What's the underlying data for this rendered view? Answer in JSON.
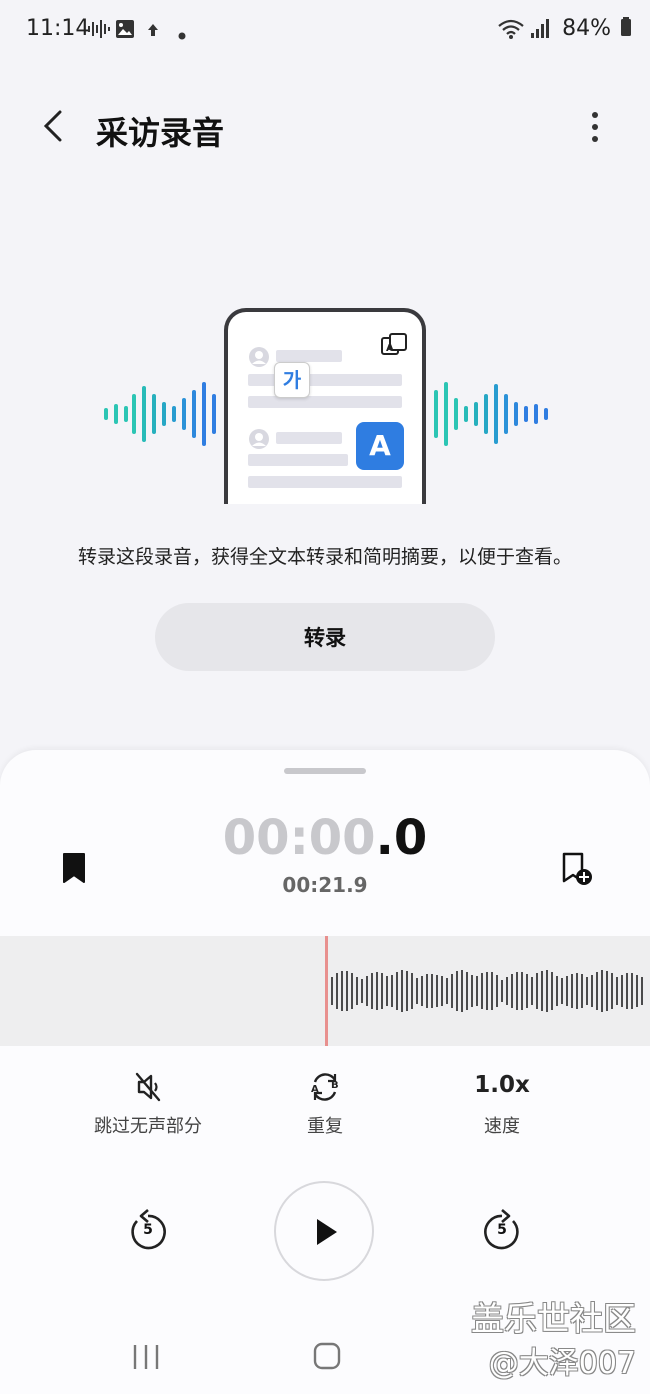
{
  "status_bar": {
    "time": "11:14",
    "battery": "84%"
  },
  "header": {
    "title": "采访录音",
    "back_icon": "chevron-left-icon",
    "more_icon": "more-vertical-icon"
  },
  "illustration": {
    "bubble_korean": "가",
    "bubble_latin": "A"
  },
  "description": "转录这段录音，获得全文本转录和简明摘要，以便于查看。",
  "transcribe_button": "转录",
  "player": {
    "timer_dim": "00:00",
    "timer_fraction": ".0",
    "total_time": "00:21.9",
    "controls": {
      "skip_silence_label": "跳过无声部分",
      "repeat_label": "重复",
      "speed_value": "1.0x",
      "speed_label": "速度"
    },
    "rewind_seconds": "5",
    "forward_seconds": "5"
  },
  "watermark": {
    "line1": "盖乐世社区",
    "line2": "@大泽007"
  },
  "colors": {
    "accent_blue": "#2f7de1",
    "wave_teal": "#2bc5b4",
    "playhead": "#e8908e"
  }
}
